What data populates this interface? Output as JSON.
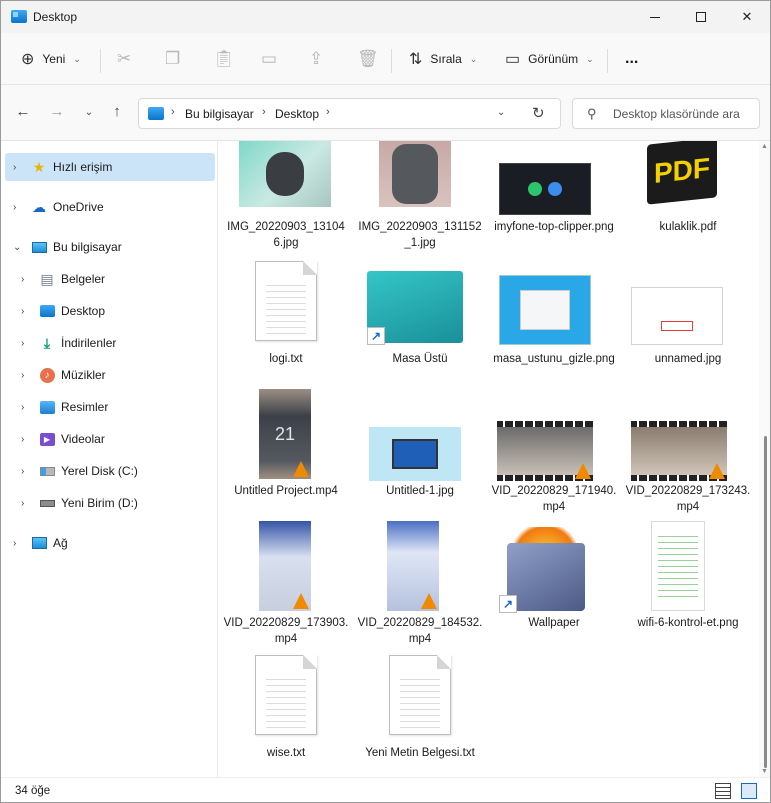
{
  "window": {
    "title": "Desktop"
  },
  "toolbar": {
    "new_label": "Yeni",
    "sort_label": "Sırala",
    "view_label": "Görünüm",
    "more_label": "..."
  },
  "address": {
    "crumbs": [
      "Bu bilgisayar",
      "Desktop"
    ],
    "search_placeholder": "Desktop klasöründe ara"
  },
  "sidebar": {
    "items": [
      {
        "label": "Hızlı erişim",
        "icon": "star-icon"
      },
      {
        "label": "OneDrive",
        "icon": "cloud-icon"
      },
      {
        "label": "Bu bilgisayar",
        "icon": "monitor-icon"
      },
      {
        "label": "Belgeler",
        "icon": "documents-icon"
      },
      {
        "label": "Desktop",
        "icon": "desktop-icon"
      },
      {
        "label": "İndirilenler",
        "icon": "download-icon"
      },
      {
        "label": "Müzikler",
        "icon": "music-icon"
      },
      {
        "label": "Resimler",
        "icon": "pictures-icon"
      },
      {
        "label": "Videolar",
        "icon": "videos-icon"
      },
      {
        "label": "Yerel Disk (C:)",
        "icon": "drive-c-icon"
      },
      {
        "label": "Yeni Birim (D:)",
        "icon": "drive-d-icon"
      },
      {
        "label": "Ağ",
        "icon": "network-icon"
      }
    ]
  },
  "files": [
    {
      "name": "IMG_20220903_131046.jpg",
      "kind": "photo-mouse-box"
    },
    {
      "name": "IMG_20220903_131152_1.jpg",
      "kind": "photo-mouse-bottom"
    },
    {
      "name": "imyfone-top-clipper.png",
      "kind": "screenshot-dark"
    },
    {
      "name": "kulaklik.pdf",
      "kind": "pdf"
    },
    {
      "name": "logi.txt",
      "kind": "text"
    },
    {
      "name": "Masa Üstü",
      "kind": "folder-shortcut"
    },
    {
      "name": "masa_ustunu_gizle.png",
      "kind": "screenshot-blue"
    },
    {
      "name": "unnamed.jpg",
      "kind": "screenshot-white"
    },
    {
      "name": "Untitled Project.mp4",
      "kind": "video-phone"
    },
    {
      "name": "Untitled-1.jpg",
      "kind": "laptop-image"
    },
    {
      "name": "VID_20220829_171940.mp4",
      "kind": "video-film"
    },
    {
      "name": "VID_20220829_173243.mp4",
      "kind": "video-film"
    },
    {
      "name": "VID_20220829_173903.mp4",
      "kind": "video-phone"
    },
    {
      "name": "VID_20220829_184532.mp4",
      "kind": "video-phone"
    },
    {
      "name": "Wallpaper",
      "kind": "folder-fire-shortcut"
    },
    {
      "name": "wifi-6-kontrol-et.png",
      "kind": "screenshot-white"
    },
    {
      "name": "wise.txt",
      "kind": "text"
    },
    {
      "name": "Yeni Metin Belgesi.txt",
      "kind": "text"
    }
  ],
  "status": {
    "count_label": "34 öğe"
  },
  "colors": {
    "accent": "#0067c0",
    "selection": "#cce4f7"
  }
}
